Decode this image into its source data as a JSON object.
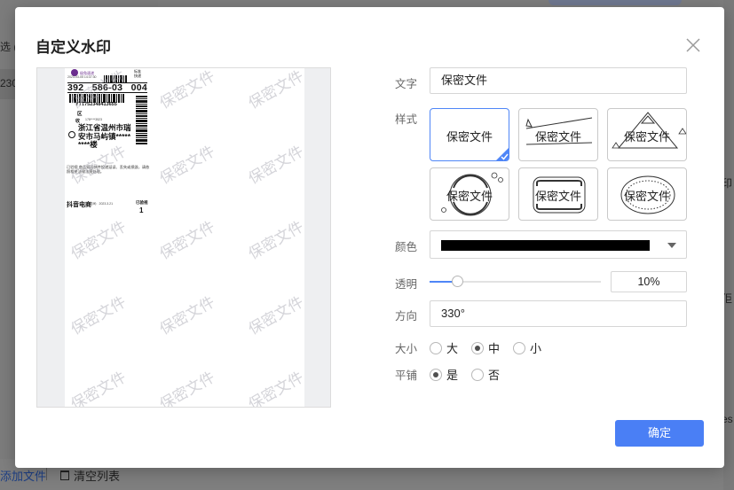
{
  "background": {
    "left_select_text": "选 (",
    "left_row_text": "230",
    "add_file": "添加文件",
    "clear_list": "清空列表",
    "right_t1": "印",
    "right_t2": "佢",
    "right_t3": "es"
  },
  "dialog": {
    "title": "自定义水印",
    "close_icon": "close-icon",
    "ok_label": "确定"
  },
  "preview": {
    "watermark_text": "保密文件",
    "label": {
      "brand": "极兔速递",
      "std": "标准\n快递",
      "date": "2023-03-05  14:37:30",
      "code_parts": [
        "392",
        "586-03",
        "004"
      ],
      "tracking": "YT1752348413655",
      "area": "区",
      "recipient": "收",
      "phone": "178****3523",
      "address": "浙江省温州市瑞安市马屿镇*****",
      "address2": "****楼",
      "fine_print": "已验视 商品如因快件投递延误、丢失或损毁，请依照相关法律法规处理。",
      "platform": "抖音电商",
      "platform_sub": "打印时间：2023.3.21",
      "shipped": "已验视",
      "qty": "1"
    }
  },
  "form": {
    "text_label": "文字",
    "text_value": "保密文件",
    "style_label": "样式",
    "style_tiles": [
      {
        "text": "保密文件",
        "selected": true
      },
      {
        "text": "保密文件",
        "selected": false
      },
      {
        "text": "保密文件",
        "selected": false
      },
      {
        "text": "保密文件",
        "selected": false
      },
      {
        "text": "保密文件",
        "selected": false
      },
      {
        "text": "保密文件",
        "selected": false
      }
    ],
    "color_label": "颜色",
    "color_value": "#000000",
    "opacity_label": "透明",
    "opacity_value": "10%",
    "opacity_fraction": 0.1,
    "direction_label": "方向",
    "direction_value": "330°",
    "size_label": "大小",
    "size_options": [
      "大",
      "中",
      "小"
    ],
    "size_selected": "中",
    "tile_label": "平铺",
    "tile_options": [
      "是",
      "否"
    ],
    "tile_selected": "是"
  },
  "colors": {
    "accent": "#4a7ff5",
    "dialog_bg": "#ffffff",
    "overlay": "#808080"
  }
}
